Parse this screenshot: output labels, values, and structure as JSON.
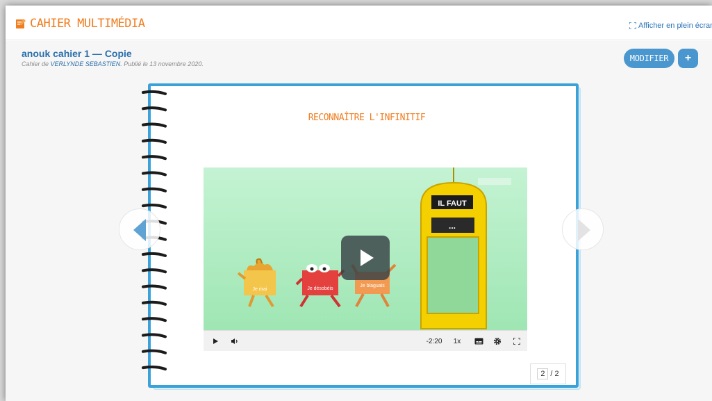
{
  "app": {
    "title": "CAHIER MULTIMÉDIA",
    "fullscreen_label": "Afficher en plein écran"
  },
  "doc": {
    "title": "anouk cahier 1 — Copie",
    "subtitle_prefix": "Cahier de ",
    "author": "VERLYNDE SEBASTIEN",
    "subtitle_suffix": ". Publié le 13 novembre 2020."
  },
  "toolbar": {
    "modify_label": "MODIFIER",
    "add_label": "+"
  },
  "page": {
    "lesson_title": "RECONNAÎTRE L'INFINITIF"
  },
  "video": {
    "sign_label": "IL FAUT",
    "sign_dots": "...",
    "characters": [
      "Je rirai",
      "Je désobéis",
      "Je blaguais"
    ],
    "time_remaining": "-2:20",
    "speed": "1x"
  },
  "pagination": {
    "current": "2",
    "total": "/ 2"
  },
  "colors": {
    "brand": "#f07d1e",
    "accent": "#4a97cf",
    "notebook_border": "#3aa2d8"
  },
  "icons": [
    "notebook-icon",
    "fullscreen-icon",
    "prev-arrow-icon",
    "next-arrow-icon",
    "play-icon",
    "volume-icon",
    "captions-icon",
    "settings-icon",
    "fullscreen-video-icon"
  ]
}
